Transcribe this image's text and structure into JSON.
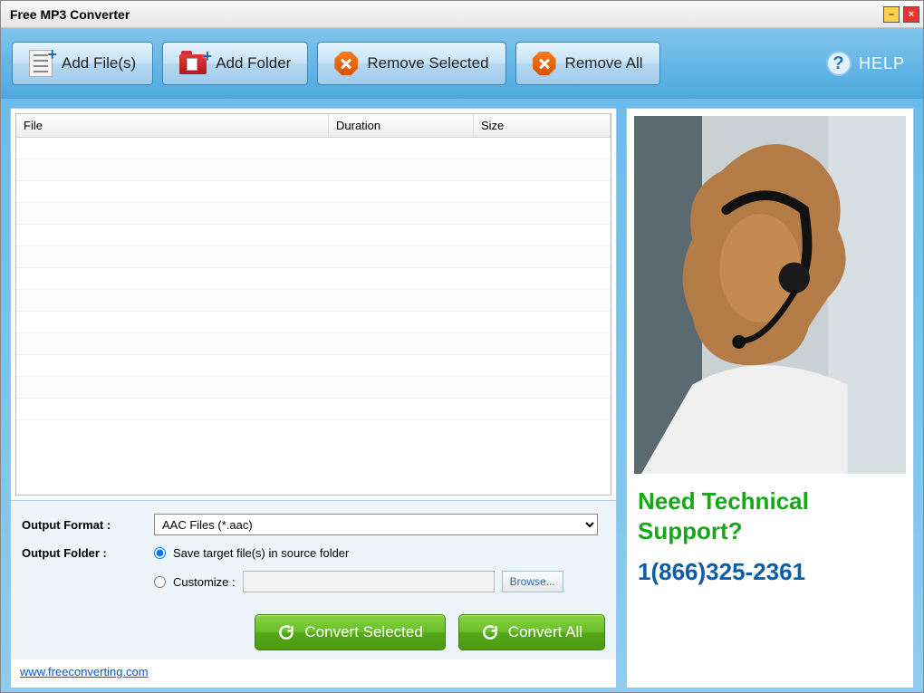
{
  "window": {
    "title": "Free MP3 Converter"
  },
  "toolbar": {
    "add_files": "Add File(s)",
    "add_folder": "Add Folder",
    "remove_selected": "Remove Selected",
    "remove_all": "Remove All",
    "help": "HELP"
  },
  "table": {
    "col_file": "File",
    "col_duration": "Duration",
    "col_size": "Size",
    "rows": []
  },
  "settings": {
    "format_label": "Output Format :",
    "format_value": "AAC Files (*.aac)",
    "folder_label": "Output Folder :",
    "source_option": "Save target file(s) in source folder",
    "customize_option": "Customize :",
    "browse": "Browse...",
    "convert_selected": "Convert Selected",
    "convert_all": "Convert All"
  },
  "footer": {
    "link_text": "www.freeconverting.com"
  },
  "sidebar": {
    "ad_title": "Need Technical Support?",
    "ad_phone": "1(866)325-2361"
  }
}
